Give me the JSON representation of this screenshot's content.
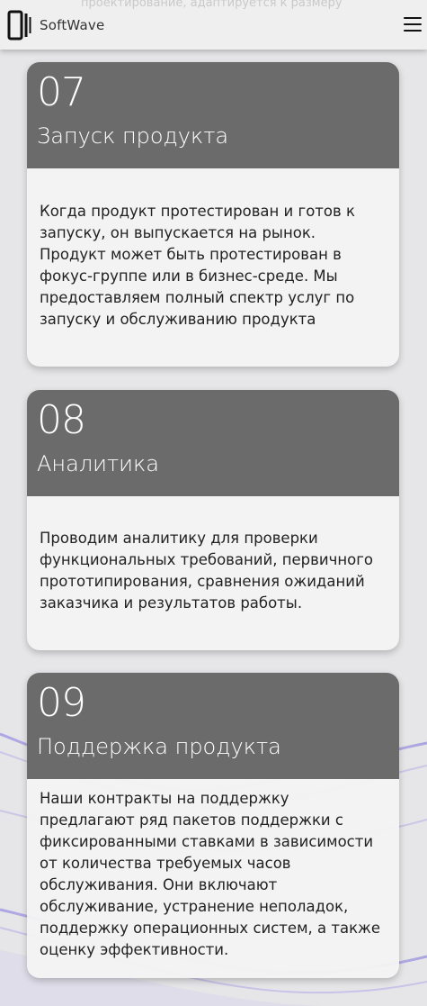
{
  "header": {
    "brand": "SoftWave",
    "logo_icon": "softwave-logo-icon",
    "menu_icon": "hamburger-menu-icon",
    "faded_text": "проектирование, адаптируется к размеру"
  },
  "cards": [
    {
      "number": "07",
      "title": "Запуск продукта",
      "text": "Когда продукт протестирован и готов к запуску, он выпускается на рынок. Продукт может быть протестирован в фокус-группе или в бизнес-среде. Мы предоставляем полный спектр услуг по запуску и обслуживанию продукта"
    },
    {
      "number": "08",
      "title": "Аналитика",
      "text": "Проводим аналитику для проверки функциональных требований, первичного прототипирования, сравнения ожиданий заказчика и результатов работы."
    },
    {
      "number": "09",
      "title": "Поддержка продукта",
      "text": "Наши контракты на поддержку предлагают ряд пакетов поддержки с фиксированными ставками в зависимости от количества требуемых часов обслуживания. Они включают обслуживание, устранение неполадок, поддержку операционных систем, а также оценку эффективности."
    }
  ],
  "colors": {
    "page_background": "#e6e6e8",
    "card_header": "#6b6b6b",
    "card_body": "#f3f3f3",
    "wave_accent": "#8f7fe0"
  }
}
